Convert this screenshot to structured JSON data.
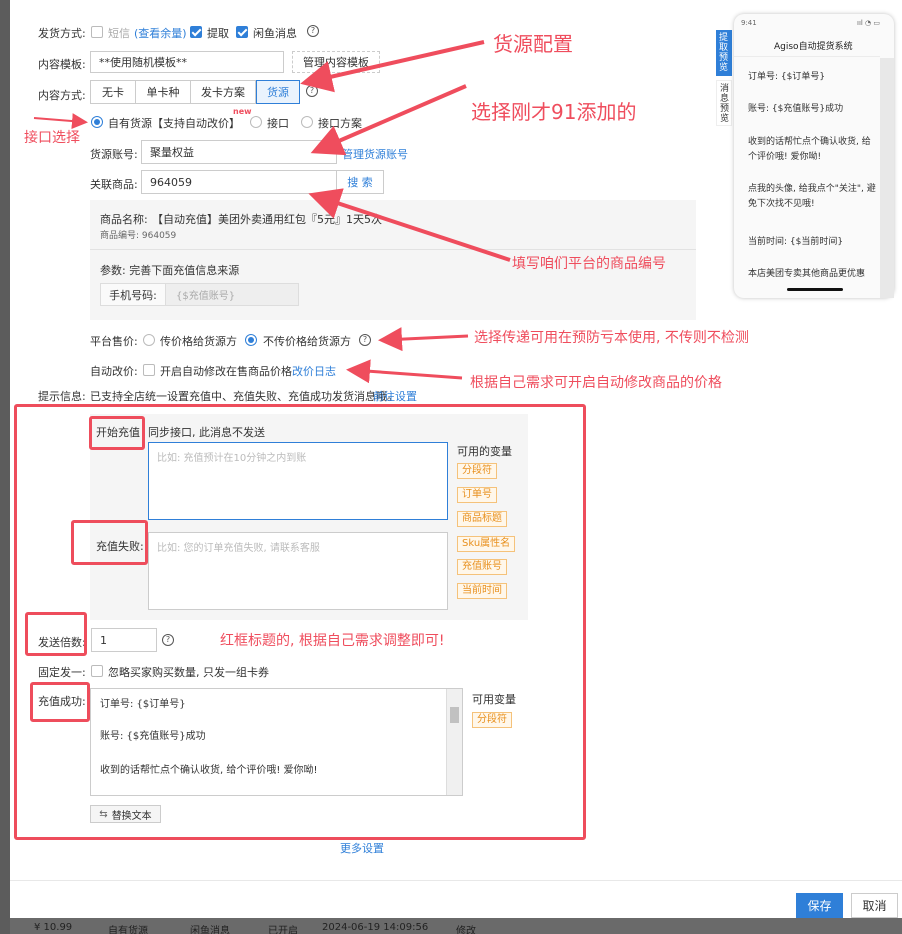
{
  "form": {
    "ship_method": {
      "label": "发货方式:",
      "options": [
        {
          "label": "短信",
          "checked": false
        },
        {
          "label": "提取",
          "checked": true
        },
        {
          "label": "闲鱼消息",
          "checked": true
        }
      ],
      "balance_link": "(查看余量)"
    },
    "template": {
      "label": "内容模板:",
      "value": "**使用随机模板**",
      "manage": "管理内容模板"
    },
    "content_mode": {
      "label": "内容方式:",
      "tabs": [
        "无卡",
        "单卡种",
        "发卡方案",
        "货源"
      ],
      "active": 3
    },
    "source_type": {
      "options": [
        "自有货源【支持自动改价】",
        "接口",
        "接口方案"
      ],
      "new_badge": "new",
      "selected": 0
    },
    "source_account": {
      "label": "货源账号:",
      "value": "聚量权益",
      "manage": "管理货源账号"
    },
    "related_product": {
      "label": "关联商品:",
      "value": "964059",
      "search": "搜 索"
    },
    "product_info": {
      "name_label": "商品名称:",
      "name": "【自动充值】美团外卖通用红包『5元』1天5次",
      "code": "商品编号: 964059",
      "params_label": "参数: 完善下面充值信息来源",
      "phone_label": "手机号码:",
      "phone_placeholder": "{$充值账号}"
    },
    "platform_price": {
      "label": "平台售价:",
      "options": [
        "传价格给货源方",
        "不传价格给货源方"
      ],
      "selected": 1
    },
    "auto_price": {
      "label": "自动改价:",
      "text": "开启自动修改在售商品价格",
      "log": "改价日志"
    },
    "hint": {
      "label": "提示信息:",
      "text": "已支持全店统一设置充值中、充值失败、充值成功发货消息哦。",
      "link": "前往设置"
    },
    "start_msg": {
      "label": "开始充值",
      "text": "同步接口, 此消息不发送",
      "placeholder": "比如: 充值预计在10分钟之内到账"
    },
    "fail_msg": {
      "label": "充值失败:",
      "placeholder": "比如: 您的订单充值失败, 请联系客服"
    },
    "vars_title": "可用的变量",
    "vars": [
      "分段符",
      "订单号",
      "商品标题",
      "Sku属性名",
      "充值账号",
      "当前时间"
    ],
    "send_times": {
      "label": "发送倍数:",
      "value": "1"
    },
    "fixed_one": {
      "label": "固定发一:",
      "text": "忽略买家购买数量, 只发一组卡券"
    },
    "success_msg": {
      "label": "充值成功:",
      "lines": [
        "订单号: {$订单号}",
        "账号: {$充值账号}成功",
        "收到的话帮忙点个确认收货, 给个评价哦! 爱你呦!"
      ]
    },
    "vars2_title": "可用变量",
    "vars2": [
      "分段符"
    ],
    "replace_btn": "替换文本",
    "more": "更多设置"
  },
  "footer": {
    "save": "保存",
    "cancel": "取消"
  },
  "bottom_row": {
    "price": "¥ 10.99",
    "source": "自有货源",
    "msg": "闲鱼消息",
    "status": "已开启",
    "time": "2024-06-19 14:09:56",
    "edit": "修改"
  },
  "preview": {
    "tabs": [
      "提取预览",
      "消息预览"
    ],
    "time": "9:41",
    "title": "Agiso自动提货系统",
    "lines": [
      "订单号: {$订单号}",
      "账号: {$充值账号}成功",
      "收到的话帮忙点个确认收货, 给个评价哦! 爱你呦!",
      "点我的头像, 给我点个\"关注\", 避免下次找不见哦!",
      "当前时间: {$当前时间}",
      "本店美团专卖其他商品更优惠"
    ]
  },
  "annotations": {
    "source_config": "货源配置",
    "select_91": "选择刚才91添加的",
    "api_select": "接口选择",
    "fill_code": "填写咱们平台的商品编号",
    "pass_price": "选择传递可用在预防亏本使用, 不传则不检测",
    "auto_price_tip": "根据自己需求可开启自动修改商品的价格",
    "red_box_tip": "红框标题的, 根据自己需求调整即可!"
  },
  "colors": {
    "accent": "#2f7fd8",
    "annotation": "#ef4d5d",
    "tag": "#e8901e"
  }
}
